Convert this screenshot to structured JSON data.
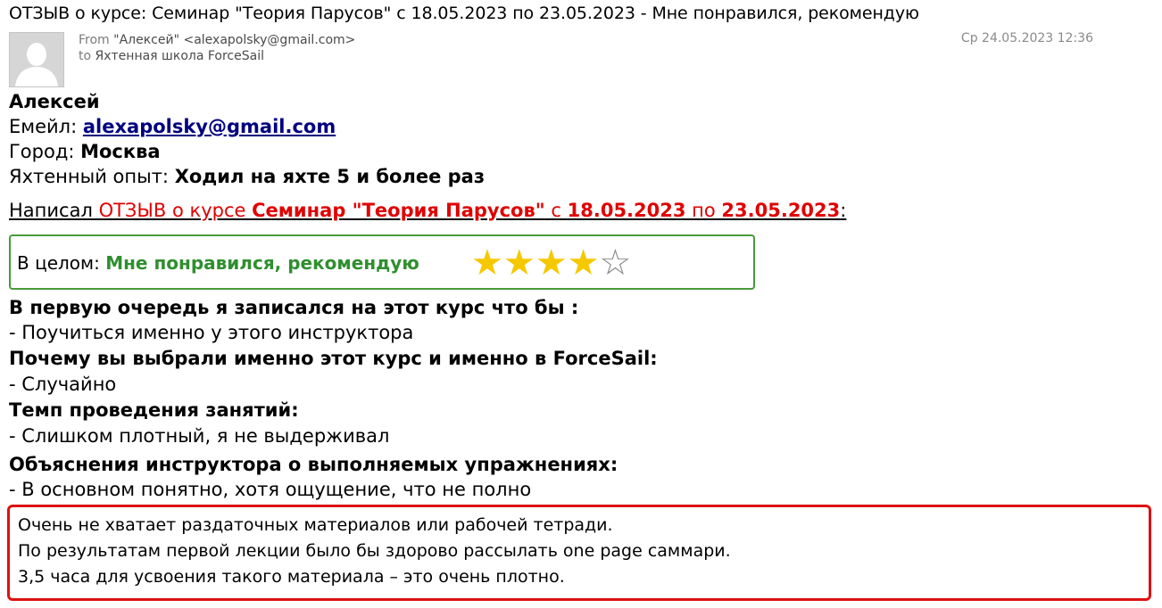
{
  "email": {
    "subject": "ОТЗЫВ о курсе: Семинар \"Теория Парусов\" с 18.05.2023 по 23.05.2023 - Мне понравился, рекомендую",
    "from_label": "From",
    "from_value": "\"Алексей\" <alexapolsky@gmail.com>",
    "to_label": "to",
    "to_value": "Яхтенная школа ForceSail",
    "date": "Ср 24.05.2023 12:36",
    "avatar_icon": "person-silhouette-icon"
  },
  "body": {
    "name": "Алексей",
    "email_label": "Емейл: ",
    "email_value": "alexapolsky@gmail.com",
    "city_label": "Город: ",
    "city_value": "Москва",
    "experience_label": "Яхтенный опыт: ",
    "experience_value": "Ходил на яхте 5 и более раз",
    "wrote": {
      "p1": "Написал ",
      "p2": "ОТЗЫВ о курсе ",
      "p3": "Семинар \"Теория Парусов\"",
      "p4": " с ",
      "p5": "18.05.2023",
      "p6": " по ",
      "p7": "23.05.2023",
      "p8": ":"
    },
    "overall": {
      "label": "В целом: ",
      "value": "Мне понравился, рекомендую",
      "rating": 4,
      "rating_max": 5,
      "star_color": "#f5c800"
    },
    "qa": [
      {
        "q": "В первую очередь я записался на этот курс что бы :",
        "a": "- Поучиться именно у этого инструктора"
      },
      {
        "q": "Почему вы выбрали именно этот курс и именно в ForceSail:",
        "a": "- Случайно"
      },
      {
        "q": "Темп проведения занятий:",
        "a": "- Слишком плотный, я не выдерживал"
      },
      {
        "q": "Объяснения инструктора о выполняемых упражнениях:",
        "a": "- В основном понятно, хотя ощущение, что не полно"
      }
    ],
    "comment": [
      "Очень не хватает раздаточных материалов или рабочей тетради.",
      "По результатам первой лекции было бы здорово рассылать one page саммари.",
      "3,5 часа для усвоения такого материала – это очень плотно."
    ]
  }
}
